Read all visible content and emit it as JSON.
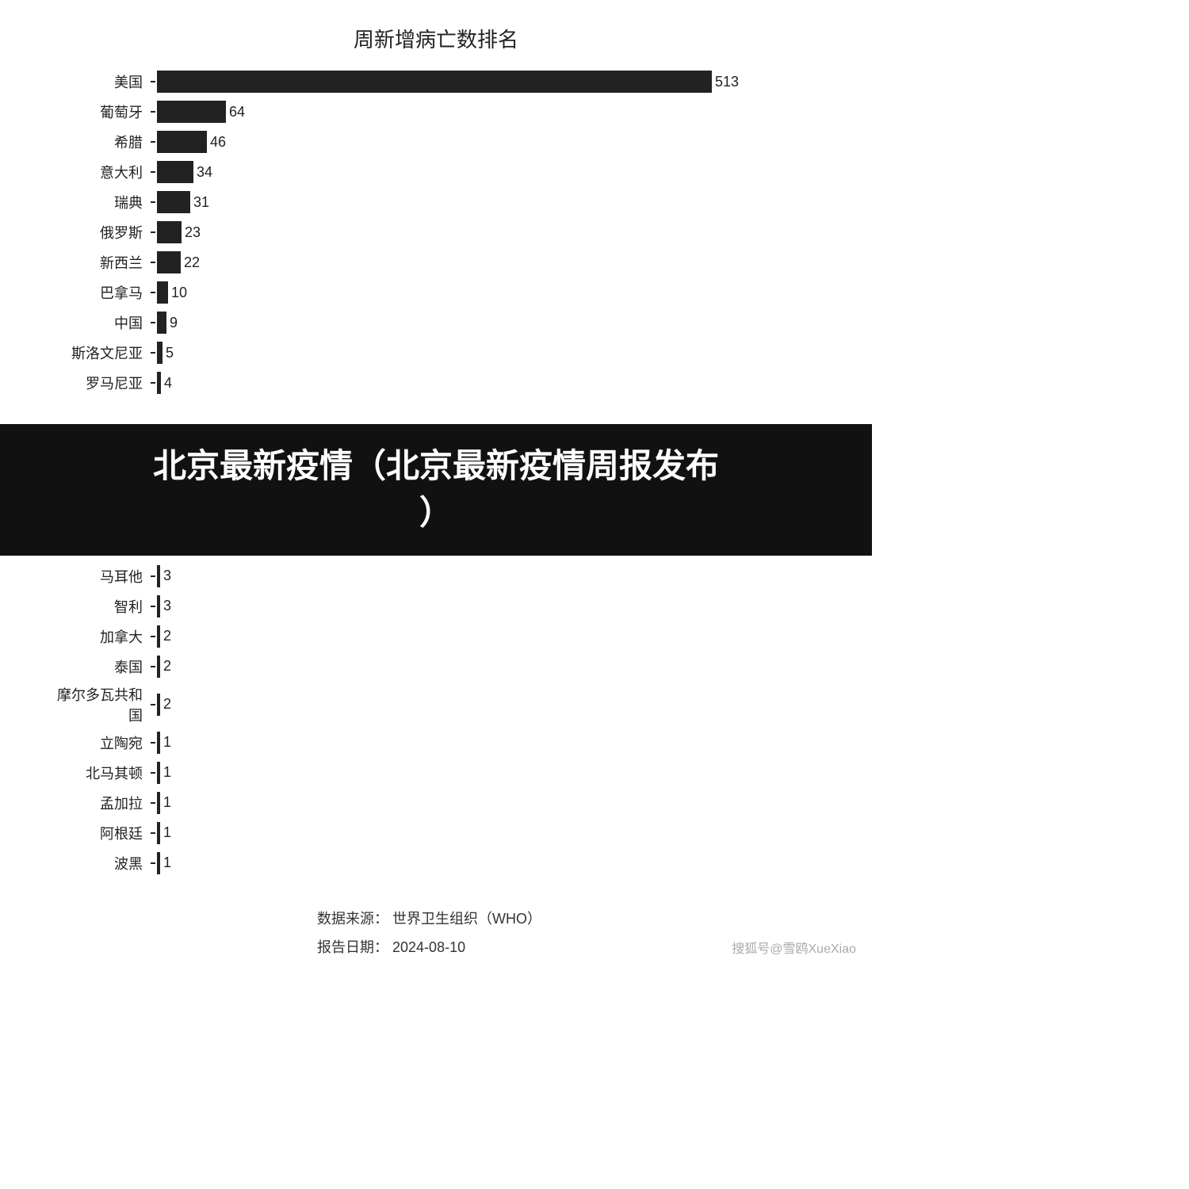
{
  "title": "周新增病亡数排名",
  "bars": [
    {
      "label": "美国",
      "value": 513,
      "max": 513
    },
    {
      "label": "葡萄牙",
      "value": 64,
      "max": 513
    },
    {
      "label": "希腊",
      "value": 46,
      "max": 513
    },
    {
      "label": "意大利",
      "value": 34,
      "max": 513
    },
    {
      "label": "瑞典",
      "value": 31,
      "max": 513
    },
    {
      "label": "俄罗斯",
      "value": 23,
      "max": 513
    },
    {
      "label": "新西兰",
      "value": 22,
      "max": 513
    },
    {
      "label": "巴拿马",
      "value": 10,
      "max": 513
    },
    {
      "label": "中国",
      "value": 9,
      "max": 513
    },
    {
      "label": "斯洛文尼亚",
      "value": 5,
      "max": 513
    },
    {
      "label": "罗马尼亚",
      "value": 4,
      "max": 513
    }
  ],
  "banner": {
    "line1": "北京最新疫情（北京最新疫情周报发布",
    "line2": "）"
  },
  "bars2": [
    {
      "label": "马耳他",
      "value": 3,
      "max": 513
    },
    {
      "label": "智利",
      "value": 3,
      "max": 513
    },
    {
      "label": "加拿大",
      "value": 2,
      "max": 513
    },
    {
      "label": "泰国",
      "value": 2,
      "max": 513
    },
    {
      "label": "摩尔多瓦共和国",
      "value": 2,
      "max": 513
    },
    {
      "label": "立陶宛",
      "value": 1,
      "max": 513
    },
    {
      "label": "北马其顿",
      "value": 1,
      "max": 513
    },
    {
      "label": "孟加拉",
      "value": 1,
      "max": 513
    },
    {
      "label": "阿根廷",
      "value": 1,
      "max": 513
    },
    {
      "label": "波黑",
      "value": 1,
      "max": 513
    }
  ],
  "footer": {
    "source_label": "数据来源：",
    "source_value": "世界卫生组织（WHO）",
    "date_label": "报告日期：",
    "date_value": "2024-08-10"
  },
  "watermark": "搜狐号@雪鸥XueXiao"
}
